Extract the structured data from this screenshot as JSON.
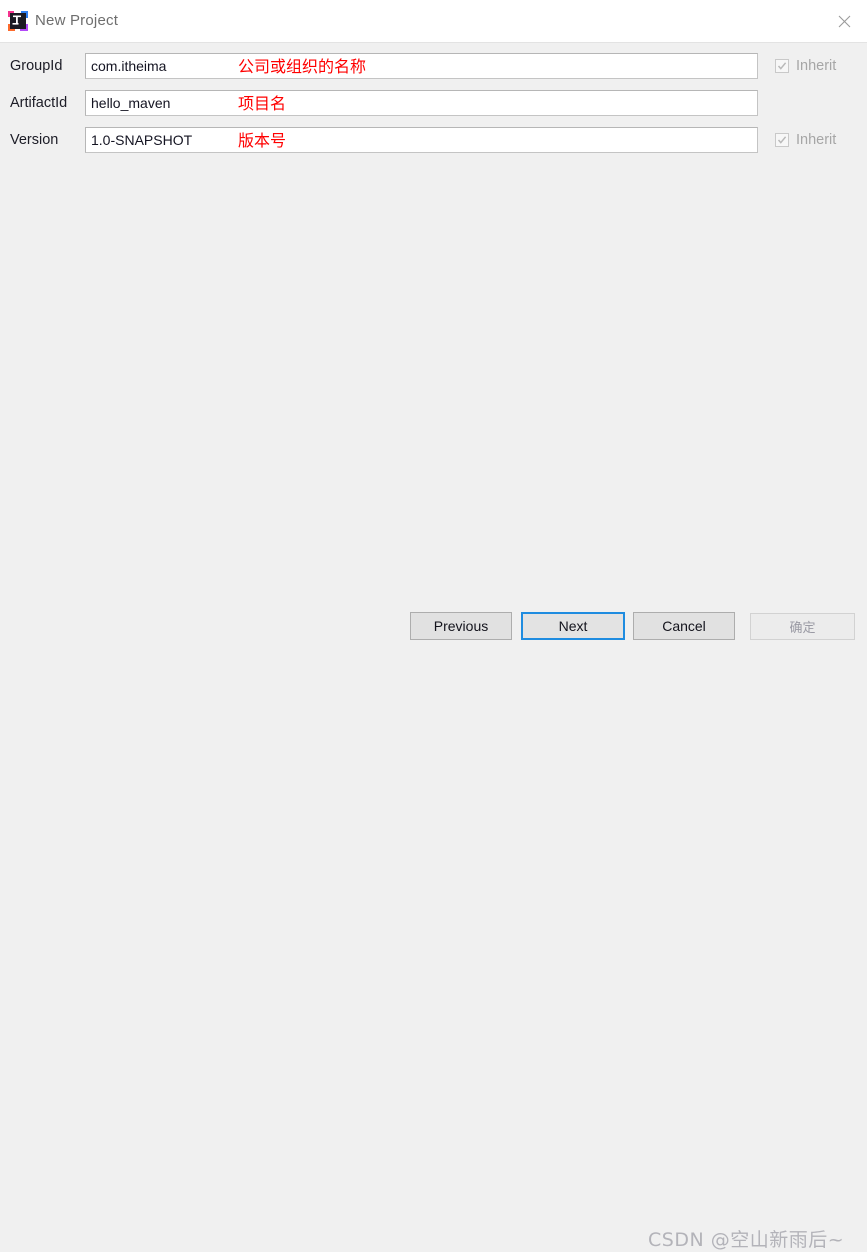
{
  "window": {
    "title": "New Project",
    "icon": "intellij-idea-icon",
    "close_icon": "close-icon",
    "titlebar_bg": "#ffffff",
    "body_bg": "#f0f0f0"
  },
  "form": {
    "rows": [
      {
        "label": "GroupId",
        "value": "com.itheima",
        "annotation": "公司或组织的名称",
        "has_inherit": true,
        "inherit_label": "Inherit",
        "inherit_checked": true,
        "inherit_disabled": true
      },
      {
        "label": "ArtifactId",
        "value": "hello_maven",
        "annotation": "项目名",
        "has_inherit": false,
        "inherit_label": "",
        "inherit_checked": false,
        "inherit_disabled": false
      },
      {
        "label": "Version",
        "value": "1.0-SNAPSHOT",
        "annotation": "版本号",
        "has_inherit": true,
        "inherit_label": "Inherit",
        "inherit_checked": true,
        "inherit_disabled": true
      }
    ],
    "annotation_color": "#ff0000"
  },
  "footer": {
    "previous_label": "Previous",
    "next_label": "Next",
    "cancel_label": "Cancel",
    "ghost_label": "确定",
    "focus_color": "#1f8ce0"
  },
  "watermark": {
    "text": "CSDN @空山新雨后~"
  }
}
